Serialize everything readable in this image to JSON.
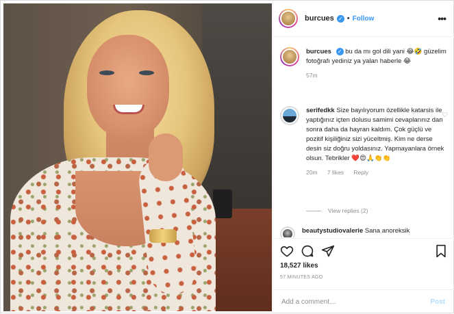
{
  "post": {
    "username": "burcues",
    "dot": "•",
    "follow_label": "Follow",
    "more_label": "•••"
  },
  "caption": {
    "username": "burcues",
    "text": "bu da mı gol dili yani 😂🤣 güzelim fotoğrafı yediniz ya yalan haberle 😂",
    "time": "57m"
  },
  "comments": [
    {
      "username": "serifedkk",
      "text": "Size bayılıyorum özellikle katarsis ile yaptığınız içten dolusu samimi cevaplarınız dan sonra daha da hayran kaldım. Çok güçlü ve pozitif kişiliğiniz sizi yüceltmiş. Kim ne derse desin siz doğru yoldasınız. Yapmayanlara örnek olsun. Tebrikler ❤️😍🙏👏👏",
      "time": "20m",
      "likes": "7 likes",
      "reply": "Reply",
      "view_replies": "View replies (2)"
    },
    {
      "username": "beautystudiovalerie",
      "text": "Sana anoreksik"
    }
  ],
  "actions": {
    "like_icon": "heart-icon",
    "comment_icon": "comment-icon",
    "share_icon": "share-icon",
    "save_icon": "bookmark-icon"
  },
  "likes": "18,527 likes",
  "posted_ago": "57 MINUTES AGO",
  "add_comment": {
    "placeholder": "Add a comment…",
    "post_label": "Post"
  },
  "colors": {
    "link": "#3897f0",
    "post_disabled": "#b2dffc",
    "muted": "#8e8e8e"
  }
}
